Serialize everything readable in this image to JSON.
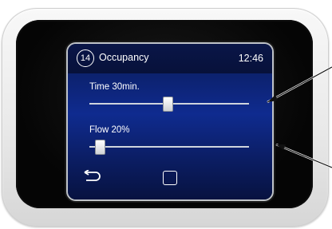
{
  "screen": {
    "number": "14",
    "title": "Occupancy",
    "time": "12:46"
  },
  "sliders": [
    {
      "label": "Time 30min.",
      "value": 0.49
    },
    {
      "label": "Flow 20%",
      "value": 0.04
    }
  ],
  "nav": {
    "back_icon": "return-arrow-icon",
    "home_icon": "square-icon"
  },
  "colors": {
    "screen_bg": "#0f2b8f",
    "text": "#ffffff",
    "bezel": "#e9e9e9"
  }
}
